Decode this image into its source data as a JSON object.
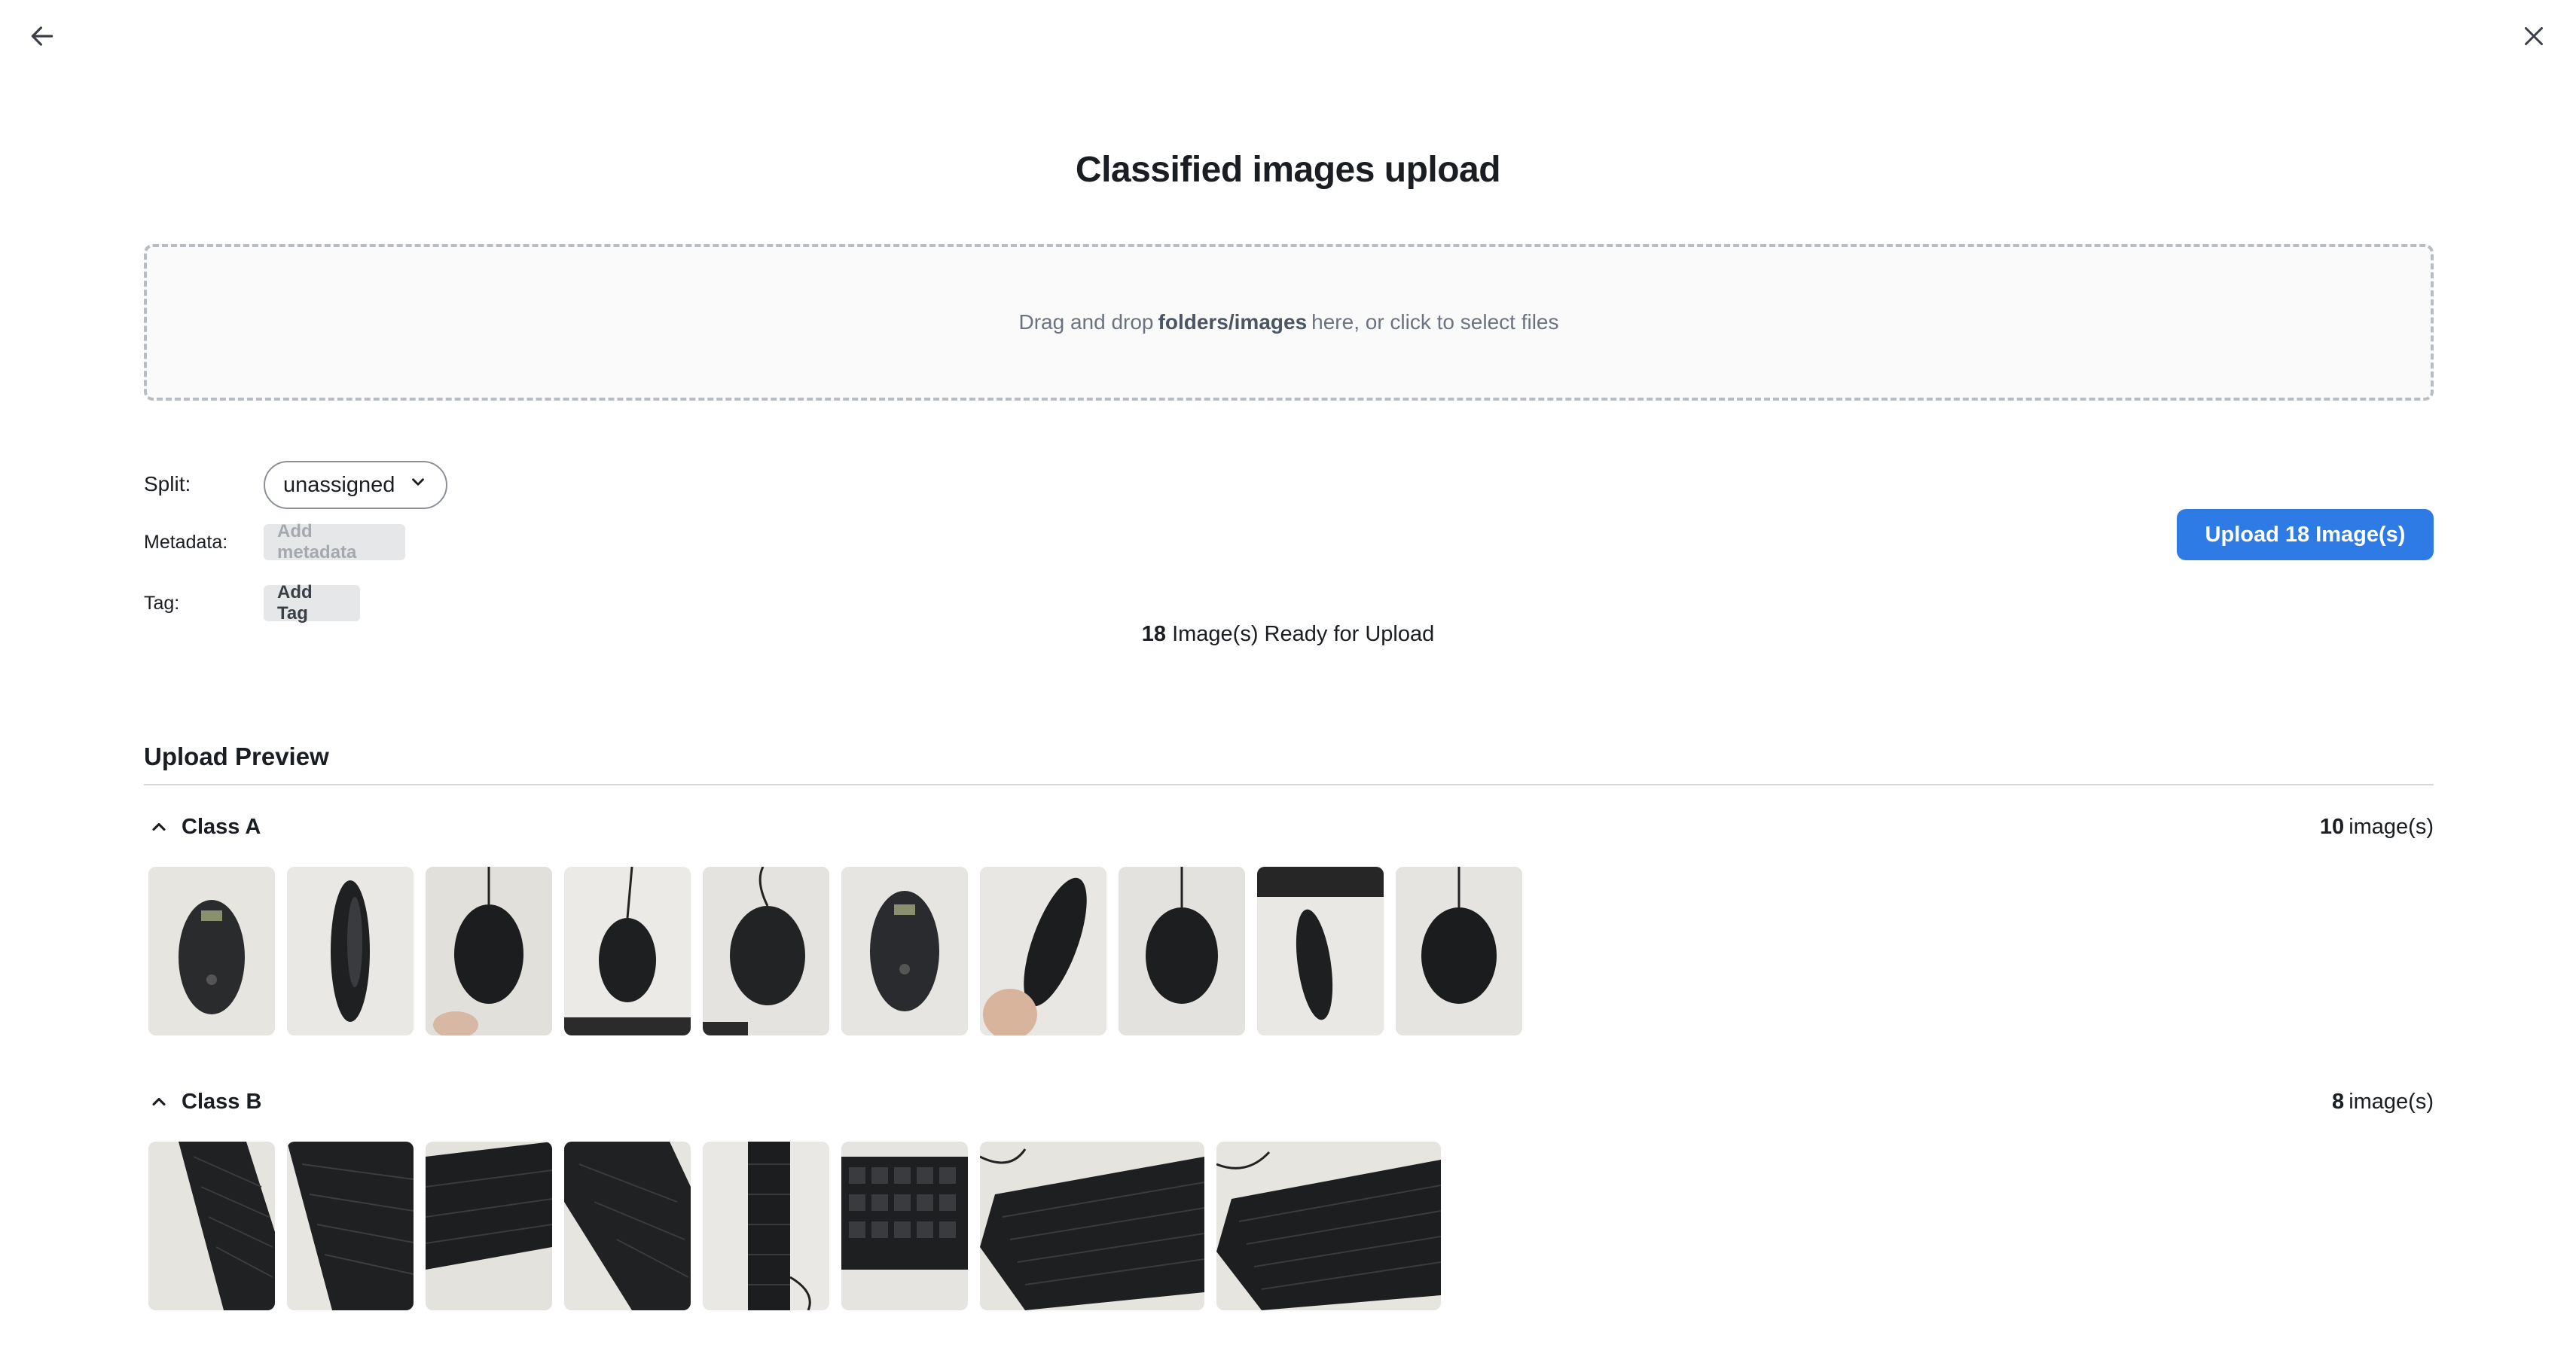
{
  "modal": {
    "title": "Classified images upload"
  },
  "dropzone": {
    "text_before": "Drag and drop",
    "text_bold": "folders/images",
    "text_after": "here, or click to select files"
  },
  "options": {
    "split_label": "Split:",
    "split_value": "unassigned",
    "metadata_label": "Metadata:",
    "metadata_button": "Add metadata",
    "tag_label": "Tag:",
    "tag_button": "Add Tag"
  },
  "upload_button": "Upload 18 Image(s)",
  "ready": {
    "count": "18",
    "text": "Image(s) Ready for Upload"
  },
  "preview": {
    "title": "Upload Preview",
    "classes": [
      {
        "name": "Class A",
        "count": "10",
        "count_suffix": "image(s)",
        "thumbnails": [
          "mouse",
          "mouse",
          "mouse",
          "mouse",
          "mouse",
          "mouse",
          "mouse",
          "mouse",
          "mouse",
          "mouse"
        ]
      },
      {
        "name": "Class B",
        "count": "8",
        "count_suffix": "image(s)",
        "thumbnails": [
          "keyboard",
          "keyboard",
          "keyboard",
          "keyboard",
          "keyboard",
          "keyboard",
          "keyboard",
          "keyboard"
        ]
      }
    ]
  },
  "colors": {
    "primary": "#2f7be5",
    "text": "#1a1d21",
    "muted": "#6b7280"
  },
  "icons": {
    "back": "arrow-left-icon",
    "close": "close-icon",
    "collapse": "chevron-up-icon",
    "dropdown": "chevron-down-icon"
  }
}
